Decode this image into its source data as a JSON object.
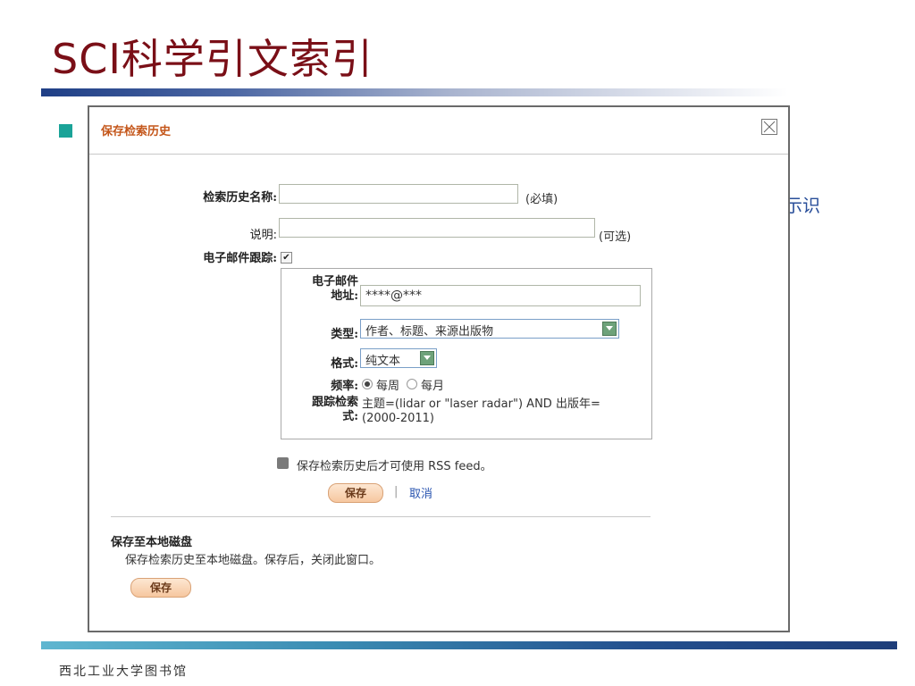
{
  "slide": {
    "title": "SCI科学引文索引",
    "behind_text": "示识",
    "footer": "西北工业大学图书馆"
  },
  "dialog": {
    "title": "保存检索历史",
    "history_name_label": "检索历史名称:",
    "history_name_value": "",
    "required_hint": "(必填)",
    "description_label": "说明:",
    "description_value": "",
    "optional_hint": "(可选)",
    "email_tracking_label": "电子邮件跟踪:",
    "email_tracking_checked": true,
    "email": {
      "address_label_line1": "电子邮件",
      "address_label_line2": "地址:",
      "address_value": "****@***",
      "type_label": "类型:",
      "type_value": "作者、标题、来源出版物",
      "format_label": "格式:",
      "format_value": "纯文本",
      "frequency_label": "频率:",
      "freq_weekly": "每周",
      "freq_monthly": "每月",
      "freq_selected": "每周",
      "query_label_line1": "跟踪检索",
      "query_label_line2": "式:",
      "query_line1": "主题=(lidar or \"laser radar\") AND 出版年=",
      "query_line2": "(2000-2011)"
    },
    "rss_note": "保存检索历史后才可使用 RSS feed。",
    "save_label": "保存",
    "separator": "|",
    "cancel_label": "取消",
    "local": {
      "heading": "保存至本地磁盘",
      "description": "保存检索历史至本地磁盘。保存后，关闭此窗口。",
      "save_label": "保存"
    }
  },
  "colors": {
    "title": "#7a0f17",
    "dialog_title": "#c4561a",
    "bullet": "#1aa398",
    "link": "#2a55b0"
  }
}
